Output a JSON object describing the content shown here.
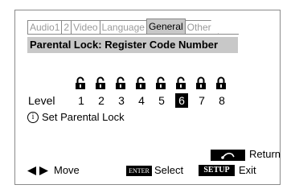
{
  "tabs": [
    {
      "label": "Audio1"
    },
    {
      "label": "2"
    },
    {
      "label": "Video"
    },
    {
      "label": "Language"
    },
    {
      "label": "General"
    },
    {
      "label": "Other"
    }
  ],
  "active_tab": "General",
  "header": {
    "title": "Parental Lock: Register Code Number"
  },
  "levels": {
    "label": "Level",
    "numbers": [
      "1",
      "2",
      "3",
      "4",
      "5",
      "6",
      "7",
      "8"
    ],
    "selected": "6",
    "lock_states": [
      "unlocked",
      "unlocked",
      "unlocked",
      "unlocked",
      "unlocked",
      "unlocked",
      "locked",
      "locked"
    ]
  },
  "info": {
    "icon": "info-icon",
    "text": "Set Parental Lock"
  },
  "footer": {
    "return_label": "Return",
    "move_label": "Move",
    "enter_key": "ENTER",
    "select_label": "Select",
    "setup_key": "SETUP",
    "exit_label": "Exit"
  },
  "colors": {
    "highlight": "#c8c8c8",
    "key_bg": "#000000",
    "inactive_text": "#9a9a9a"
  }
}
